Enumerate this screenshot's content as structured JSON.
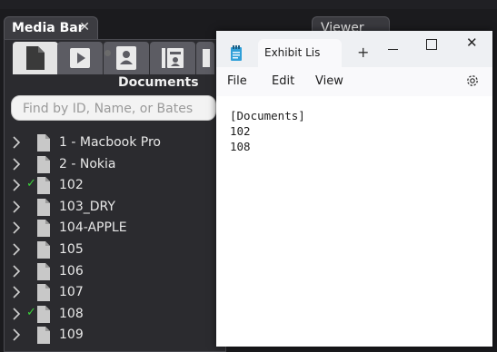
{
  "media_bar": {
    "tab_title": "Media Bar",
    "close_glyph": "✕",
    "viewer_tab_title": "Viewer",
    "toolbar_icons": [
      "document-icon",
      "play-video-icon",
      "witness-card-icon",
      "exhibit-binder-icon",
      "more-icon"
    ],
    "section_title": "Documents",
    "search_placeholder": "Find by ID, Name, or Bates",
    "items": [
      {
        "label": "1 - Macbook Pro",
        "checked": false
      },
      {
        "label": "2 - Nokia",
        "checked": false
      },
      {
        "label": "102",
        "checked": true
      },
      {
        "label": "103_DRY",
        "checked": false
      },
      {
        "label": "104-APPLE",
        "checked": false
      },
      {
        "label": "105",
        "checked": false
      },
      {
        "label": "106",
        "checked": false
      },
      {
        "label": "107",
        "checked": false
      },
      {
        "label": "108",
        "checked": true
      },
      {
        "label": "109",
        "checked": false
      }
    ],
    "check_glyph": "✓",
    "check_color": "#3ad13a"
  },
  "notepad": {
    "tab_title": "Exhibit Lis",
    "new_tab_glyph": "+",
    "close_glyph": "✕",
    "menu": [
      "File",
      "Edit",
      "View"
    ],
    "content_lines": [
      "[Documents]",
      "102",
      "108"
    ]
  }
}
